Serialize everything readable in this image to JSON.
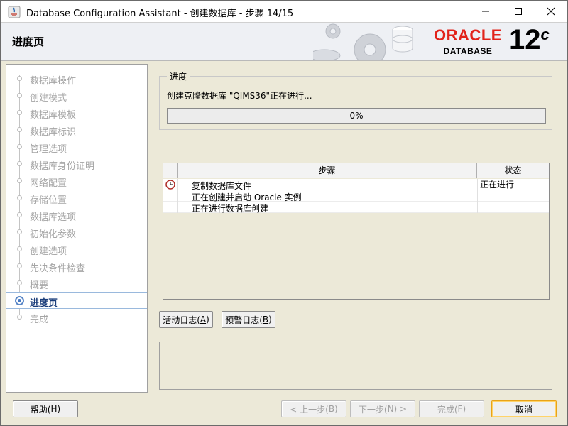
{
  "window": {
    "title": "Database Configuration Assistant - 创建数据库 - 步骤 14/15"
  },
  "header": {
    "page_title": "进度页",
    "brand": "ORACLE",
    "product": "DATABASE",
    "version_major": "12",
    "version_suffix": "c"
  },
  "nav": {
    "items": [
      {
        "label": "数据库操作",
        "state": "done"
      },
      {
        "label": "创建模式",
        "state": "done"
      },
      {
        "label": "数据库模板",
        "state": "done"
      },
      {
        "label": "数据库标识",
        "state": "done"
      },
      {
        "label": "管理选项",
        "state": "done"
      },
      {
        "label": "数据库身份证明",
        "state": "done"
      },
      {
        "label": "网络配置",
        "state": "done"
      },
      {
        "label": "存储位置",
        "state": "done"
      },
      {
        "label": "数据库选项",
        "state": "done"
      },
      {
        "label": "初始化参数",
        "state": "done"
      },
      {
        "label": "创建选项",
        "state": "done"
      },
      {
        "label": "先决条件检查",
        "state": "done"
      },
      {
        "label": "概要",
        "state": "done"
      },
      {
        "label": "进度页",
        "state": "active"
      },
      {
        "label": "完成",
        "state": "pending"
      }
    ]
  },
  "progress": {
    "legend": "进度",
    "message": "创建克隆数据库 \"QIMS36\"正在进行...",
    "percent_label": "0%",
    "fraction": 0
  },
  "steps_table": {
    "columns": {
      "step": "步骤",
      "status": "状态"
    },
    "rows": [
      {
        "icon": "clock-icon",
        "step": "复制数据库文件",
        "status": "正在进行"
      },
      {
        "icon": "",
        "step": "正在创建并启动 Oracle 实例",
        "status": ""
      },
      {
        "icon": "",
        "step": "正在进行数据库创建",
        "status": ""
      }
    ]
  },
  "log_buttons": {
    "activity_log": "活动日志(",
    "activity_log_key": "A",
    "alert_log": "预警日志(",
    "alert_log_key": "B",
    "close_paren": ")"
  },
  "buttons": {
    "help": "帮助(",
    "help_key": "H",
    "back": "< 上一步(",
    "back_key": "B",
    "next": "下一步(",
    "next_key": "N",
    "next_tail": ") >",
    "finish": "完成(",
    "finish_key": "F",
    "cancel": "取消",
    "close_paren": ")"
  },
  "colors": {
    "accent": "#5b88c8",
    "brand_red": "#e2231a",
    "progress_fill": "#4a8f3a"
  }
}
